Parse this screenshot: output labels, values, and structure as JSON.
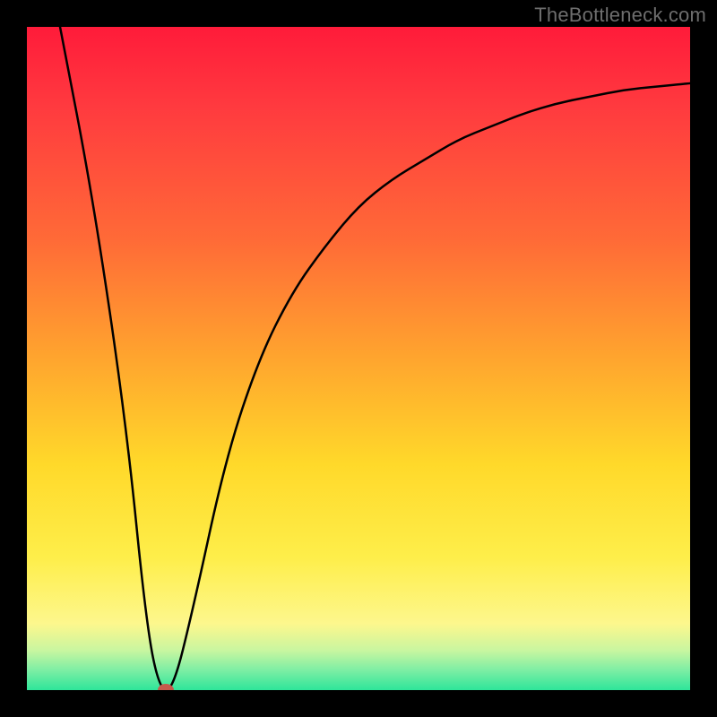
{
  "watermark": "TheBottleneck.com",
  "colors": {
    "background": "#000000",
    "curve": "#000000",
    "marker": "#c65a4c",
    "watermark_text": "#6e6e6e"
  },
  "chart_data": {
    "type": "line",
    "title": "",
    "xlabel": "",
    "ylabel": "",
    "xlim": [
      0,
      100
    ],
    "ylim": [
      0,
      100
    ],
    "grid": false,
    "legend": false,
    "categories_note": "no axis tick labels are visible",
    "series": [
      {
        "name": "bottleneck-curve",
        "description": "Black V-shaped curve with vertex near bottom; left arm steep to top-left, right arm sweeps up toward upper right with decreasing slope.",
        "x": [
          5,
          10,
          15,
          18,
          20,
          22,
          25,
          30,
          35,
          40,
          45,
          50,
          55,
          60,
          65,
          70,
          75,
          80,
          85,
          90,
          95,
          100
        ],
        "y": [
          100,
          74,
          40,
          10,
          0,
          0,
          12,
          35,
          50,
          60,
          67,
          73,
          77,
          80,
          83,
          85,
          87,
          88.5,
          89.5,
          90.5,
          91,
          91.5
        ]
      }
    ],
    "marker": {
      "x": 21,
      "y": 0,
      "label": "bottleneck-point"
    },
    "gradient_bands": [
      {
        "at": 0,
        "color": "#ff1b3a",
        "meaning": "worst"
      },
      {
        "at": 50,
        "color": "#ffa52e"
      },
      {
        "at": 80,
        "color": "#feee4a"
      },
      {
        "at": 100,
        "color": "#2ee59a",
        "meaning": "best"
      }
    ]
  }
}
